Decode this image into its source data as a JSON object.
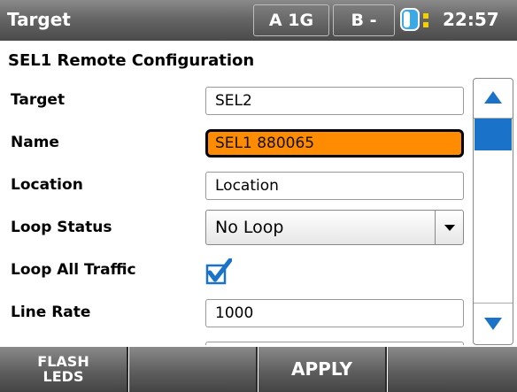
{
  "status_bar": {
    "title": "Target",
    "port_a": "A 1G",
    "port_b": "B -",
    "battery_icon": "battery-charging-icon",
    "time": "22:57"
  },
  "header": {
    "title": "SEL1 Remote Configuration"
  },
  "form": {
    "target": {
      "label": "Target",
      "value": "SEL2"
    },
    "name": {
      "label": "Name",
      "value": "SEL1 880065"
    },
    "location": {
      "label": "Location",
      "value": "Location"
    },
    "loop_status": {
      "label": "Loop Status",
      "value": "No Loop"
    },
    "loop_all_traffic": {
      "label": "Loop All Traffic",
      "checked": true
    },
    "line_rate": {
      "label": "Line Rate",
      "value": "1000"
    }
  },
  "softkeys": {
    "flash_leds": "FLASH\nLEDS",
    "apply": "APPLY"
  },
  "colors": {
    "accent_blue": "#1a73c9",
    "active_field": "#ff8b00",
    "bar_gray": "#5e5e5e"
  }
}
